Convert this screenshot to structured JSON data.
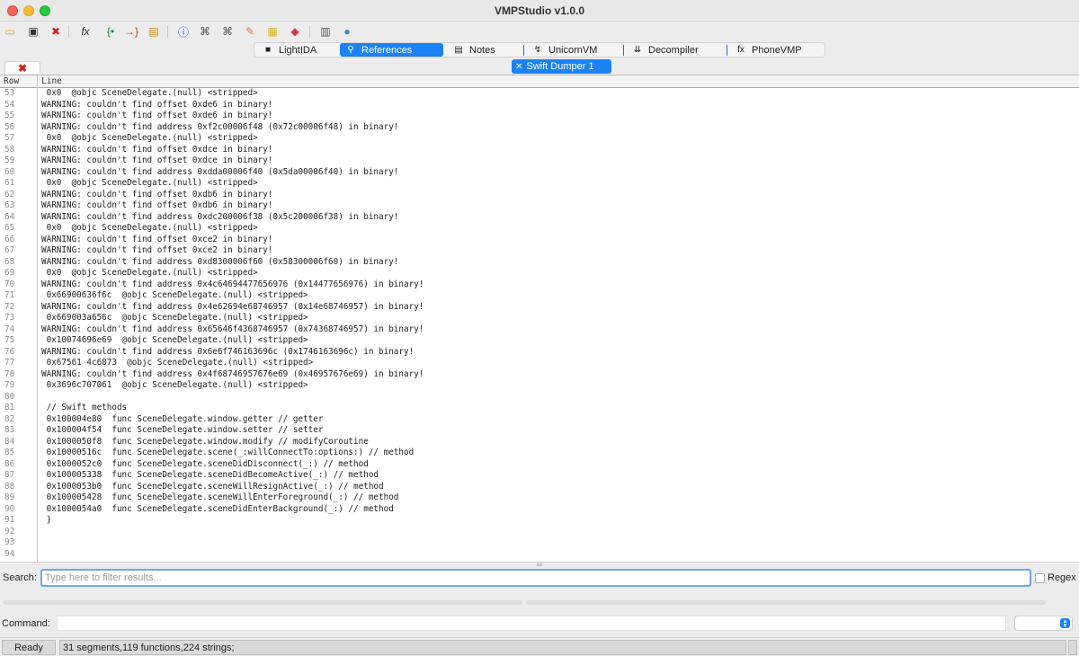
{
  "window": {
    "title": "VMPStudio v1.0.0"
  },
  "toolbar": {
    "icons": [
      {
        "name": "open-folder-icon",
        "glyph": "▭",
        "color": "#e0a800"
      },
      {
        "name": "save-icon",
        "glyph": "▣",
        "color": "#333333"
      },
      {
        "name": "close-file-icon",
        "glyph": "✖",
        "color": "#d62020"
      },
      {
        "name": "function-icon",
        "glyph": "fx",
        "color": "#333333"
      },
      {
        "name": "jump-to-entry-icon",
        "glyph": "{•",
        "color": "#1a8a3a"
      },
      {
        "name": "jump-forward-icon",
        "glyph": "→}",
        "color": "#c84010"
      },
      {
        "name": "export-icon",
        "glyph": "▤",
        "color": "#d48a10"
      },
      {
        "name": "info-icon",
        "glyph": "ⓘ",
        "color": "#1a56d6"
      },
      {
        "name": "flow-graph-icon",
        "glyph": "⌘",
        "color": "#555555"
      },
      {
        "name": "call-graph-icon",
        "glyph": "⌘",
        "color": "#555555"
      },
      {
        "name": "patch-icon",
        "glyph": "✎",
        "color": "#e07040"
      },
      {
        "name": "notes-icon",
        "glyph": "▦",
        "color": "#e0b020"
      },
      {
        "name": "eraser-icon",
        "glyph": "◆",
        "color": "#e03040"
      },
      {
        "name": "calculator-icon",
        "glyph": "▥",
        "color": "#555555"
      },
      {
        "name": "globe-icon",
        "glyph": "●",
        "color": "#2a90c8"
      }
    ]
  },
  "tabs": [
    {
      "label": "LightIDA",
      "icon": "lightida-icon",
      "glyph": "■",
      "active": false
    },
    {
      "label": "References",
      "icon": "search-icon",
      "glyph": "⚲",
      "active": true
    },
    {
      "label": "Notes",
      "icon": "notes-page-icon",
      "glyph": "▤",
      "active": false
    },
    {
      "label": "UnicornVM",
      "icon": "unicorn-icon",
      "glyph": "↯",
      "active": false
    },
    {
      "label": "Decompiler",
      "icon": "decompiler-icon",
      "glyph": "⇊",
      "active": false
    },
    {
      "label": "PhoneVMP",
      "icon": "function-icon",
      "glyph": "fx",
      "active": false
    }
  ],
  "subtab": {
    "close_glyph": "✕",
    "label": "Swift Dumper 1"
  },
  "close_tab": {
    "glyph": "✖"
  },
  "table": {
    "headers": {
      "row": "Row",
      "line": "Line"
    },
    "rows": [
      {
        "row": "53",
        "line": " 0x0  @objc SceneDelegate.(null) <stripped>"
      },
      {
        "row": "54",
        "line": "WARNING: couldn't find offset 0xde6 in binary!"
      },
      {
        "row": "55",
        "line": "WARNING: couldn't find offset 0xde6 in binary!"
      },
      {
        "row": "56",
        "line": "WARNING: couldn't find address 0xf2c00006f48 (0x72c00006f48) in binary!"
      },
      {
        "row": "57",
        "line": " 0x0  @objc SceneDelegate.(null) <stripped>"
      },
      {
        "row": "58",
        "line": "WARNING: couldn't find offset 0xdce in binary!"
      },
      {
        "row": "59",
        "line": "WARNING: couldn't find offset 0xdce in binary!"
      },
      {
        "row": "60",
        "line": "WARNING: couldn't find address 0xdda00006f40 (0x5da00006f40) in binary!"
      },
      {
        "row": "61",
        "line": " 0x0  @objc SceneDelegate.(null) <stripped>"
      },
      {
        "row": "62",
        "line": "WARNING: couldn't find offset 0xdb6 in binary!"
      },
      {
        "row": "63",
        "line": "WARNING: couldn't find offset 0xdb6 in binary!"
      },
      {
        "row": "64",
        "line": "WARNING: couldn't find address 0xdc200006f38 (0x5c200006f38) in binary!"
      },
      {
        "row": "65",
        "line": " 0x0  @objc SceneDelegate.(null) <stripped>"
      },
      {
        "row": "66",
        "line": "WARNING: couldn't find offset 0xce2 in binary!"
      },
      {
        "row": "67",
        "line": "WARNING: couldn't find offset 0xce2 in binary!"
      },
      {
        "row": "68",
        "line": "WARNING: couldn't find address 0xd8300006f60 (0x58300006f60) in binary!"
      },
      {
        "row": "69",
        "line": " 0x0  @objc SceneDelegate.(null) <stripped>"
      },
      {
        "row": "70",
        "line": "WARNING: couldn't find address 0x4c64694477656976 (0x14477656976) in binary!"
      },
      {
        "row": "71",
        "line": " 0x66900636f6c  @objc SceneDelegate.(null) <stripped>"
      },
      {
        "row": "72",
        "line": "WARNING: couldn't find address 0x4e62694e68746957 (0x14e68746957) in binary!"
      },
      {
        "row": "73",
        "line": " 0x669003a656c  @objc SceneDelegate.(null) <stripped>"
      },
      {
        "row": "74",
        "line": "WARNING: couldn't find address 0x65646f4368746957 (0x74368746957) in binary!"
      },
      {
        "row": "75",
        "line": " 0x10074696e69  @objc SceneDelegate.(null) <stripped>"
      },
      {
        "row": "76",
        "line": "WARNING: couldn't find address 0x6e6f746163696c (0x1746163696c) in binary!"
      },
      {
        "row": "77",
        "line": " 0x67561 4c6873  @objc SceneDelegate.(null) <stripped>"
      },
      {
        "row": "78",
        "line": "WARNING: couldn't find address 0x4f68746957676e69 (0x46957676e69) in binary!"
      },
      {
        "row": "79",
        "line": " 0x3696c707061  @objc SceneDelegate.(null) <stripped>"
      },
      {
        "row": "80",
        "line": ""
      },
      {
        "row": "81",
        "line": " // Swift methods"
      },
      {
        "row": "82",
        "line": " 0x100004e80  func SceneDelegate.window.getter // getter"
      },
      {
        "row": "83",
        "line": " 0x100004f54  func SceneDelegate.window.setter // setter"
      },
      {
        "row": "84",
        "line": " 0x1000050f8  func SceneDelegate.window.modify // modifyCoroutine"
      },
      {
        "row": "85",
        "line": " 0x10000516c  func SceneDelegate.scene(_:willConnectTo:options:) // method"
      },
      {
        "row": "86",
        "line": " 0x1000052c0  func SceneDelegate.sceneDidDisconnect(_:) // method"
      },
      {
        "row": "87",
        "line": " 0x100005338  func SceneDelegate.sceneDidBecomeActive(_:) // method"
      },
      {
        "row": "88",
        "line": " 0x1000053b0  func SceneDelegate.sceneWillResignActive(_:) // method"
      },
      {
        "row": "89",
        "line": " 0x100005428  func SceneDelegate.sceneWillEnterForeground(_:) // method"
      },
      {
        "row": "90",
        "line": " 0x1000054a0  func SceneDelegate.sceneDidEnterBackground(_:) // method"
      },
      {
        "row": "91",
        "line": " }"
      },
      {
        "row": "92",
        "line": ""
      },
      {
        "row": "93",
        "line": ""
      },
      {
        "row": "94",
        "line": ""
      }
    ]
  },
  "search": {
    "label": "Search:",
    "placeholder": "Type here to filter results...",
    "value": "",
    "regex_label": "Regex"
  },
  "command": {
    "label": "Command:",
    "value": ""
  },
  "status": {
    "ready": "Ready",
    "info": "31 segments,119 functions,224 strings;"
  }
}
